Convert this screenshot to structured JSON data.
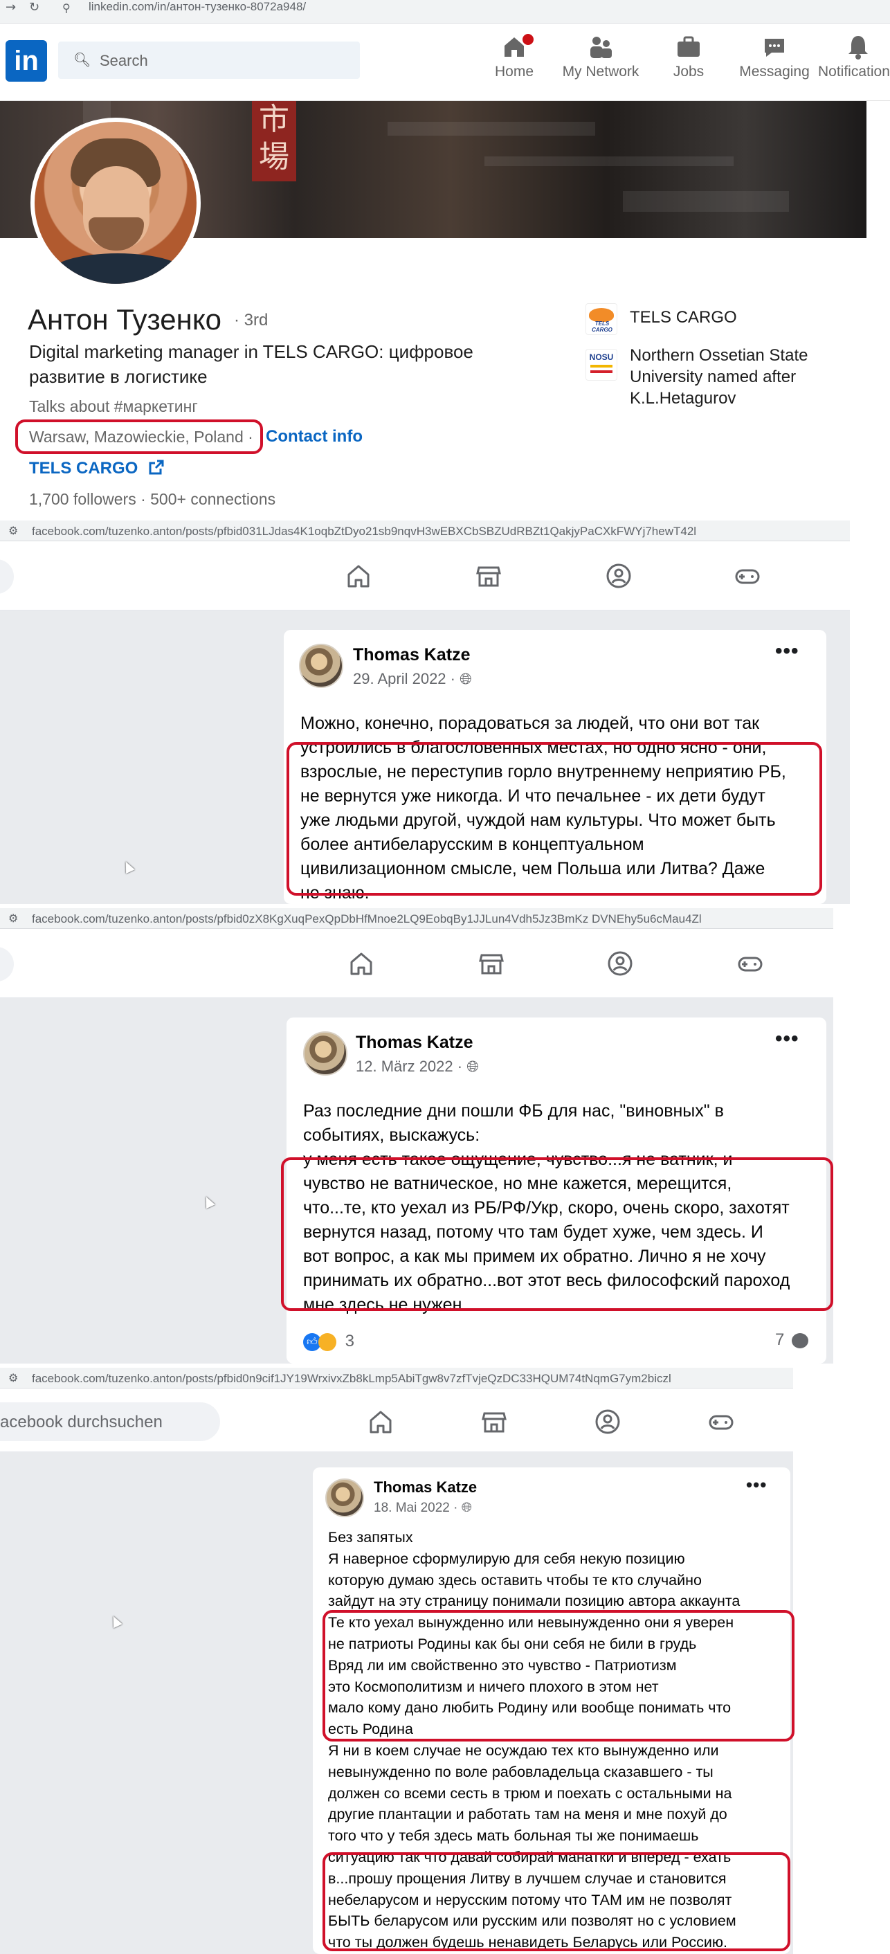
{
  "linkedin": {
    "url": "linkedin.com/in/антон-тузенко-8072a948/",
    "nav": {
      "search_placeholder": "Search",
      "items": [
        "Home",
        "My Network",
        "Jobs",
        "Messaging",
        "Notifications"
      ]
    },
    "logo_text": "in",
    "banner_sign": "市場",
    "profile": {
      "name": "Антон Тузенко",
      "degree": "· 3rd",
      "headline": "Digital marketing manager in TELS CARGO: цифровое развитие в логистике",
      "talks_about": "Talks about #маркетинг",
      "location": "Warsaw, Mazowieckie, Poland ·",
      "contact_info": "Contact info",
      "company_link": "TELS CARGO",
      "followers": "1,700 followers",
      "connections": "· 500+ connections"
    },
    "experience": [
      {
        "name": "TELS CARGO",
        "logo_text": "TELS CARGO"
      },
      {
        "name": "Northern Ossetian State University named after K.L.Hetagurov",
        "logo_text": "NOSU"
      }
    ]
  },
  "facebook_posts": [
    {
      "url": "facebook.com/tuzenko.anton/posts/pfbid031LJdas4K1oqbZtDyo21sb9nqvH3wEBXCbSBZUdRBZt1QakjyPaCXkFWYj7hewT42l",
      "author": "Thomas Katze",
      "date": "29. April 2022 ·",
      "lines": [
        "Можно, конечно, порадоваться за людей, что они вот так",
        "устроились в благословенных местах, но одно ясно - они,",
        "взрослые, не переступив горло внутреннему неприятию РБ,",
        "не вернутся уже никогда. И что печальнее - их дети будут",
        "уже людьми другой, чуждой нам культуры. Что может быть",
        "более антибеларусским в концептуальном",
        "цивилизационном смысле, чем Польша или Литва? Даже",
        "не знаю."
      ]
    },
    {
      "url": "facebook.com/tuzenko.anton/posts/pfbid0zX8KgXuqPexQpDbHfMnoe2LQ9EobqBy1JJLun4Vdh5Jz3BmKz DVNEhy5u6cMau4Zl",
      "author": "Thomas Katze",
      "date": "12. März 2022 ·",
      "lines": [
        "Раз последние дни пошли ФБ для нас, \"виновных\" в",
        "событиях, выскажусь:",
        "у меня есть такое ощущение, чувство...я не ватник, и",
        "чувство не ватническое, но мне кажется, мерещится,",
        "что...те, кто уехал из РБ/РФ/Укр, скоро, очень скоро, захотят",
        "вернутся назад, потому что там будет хуже, чем здесь. И",
        "вот вопрос, а как мы примем их обратно. Лично я не хочу",
        "принимать их обратно...вот этот весь философский пароход",
        "мне здесь не нужен."
      ],
      "reactions_count": "3",
      "comments_count": "7"
    },
    {
      "url": "facebook.com/tuzenko.anton/posts/pfbid0n9cif1JY19WrxivxZb8kLmp5AbiTgw8v7zfTvjeQzDC33HQUM74tNqmG7ym2biczl",
      "search_placeholder": "acebook durchsuchen",
      "author": "Thomas Katze",
      "date": "18. Mai 2022 ·",
      "lines": [
        "Без запятых",
        "Я наверное сформулирую для себя некую позицию",
        "которую думаю здесь оставить чтобы те кто случайно",
        "зайдут на эту страницу понимали позицию автора аккаунта",
        "Те кто уехал вынужденно или невынужденно они я уверен",
        "не патриоты Родины как бы они себя не били в грудь",
        "Вряд ли им свойственно это чувство - Патриотизм",
        "это Космополитизм и ничего плохого в этом нет",
        "мало кому дано любить Родину или вообще понимать что",
        "есть Родина",
        "Я ни в коем случае не осуждаю тех кто вынужденно или",
        "невынужденно по воле рабовладельца сказавшего - ты",
        "должен со всеми сесть в трюм и поехать с остальными на",
        "другие плантации и работать там на меня и мне похуй до",
        "того что у тебя здесь мать больная ты же понимаешь",
        "ситуацию так что давай собирай манатки и вперед - ехать",
        "в...прошу прощения Литву в лучшем случае и становится",
        "небеларусом и нерусским потому что ТАМ им не позволят",
        "БЫТЬ беларусом или русским или позволят но с условием",
        "что ты должен будешь ненавидеть Беларусь или Россию."
      ]
    }
  ],
  "colors": {
    "linkedin_blue": "#0a66c2",
    "highlight_red": "#d0102a",
    "facebook_bg": "#e9ebee"
  }
}
